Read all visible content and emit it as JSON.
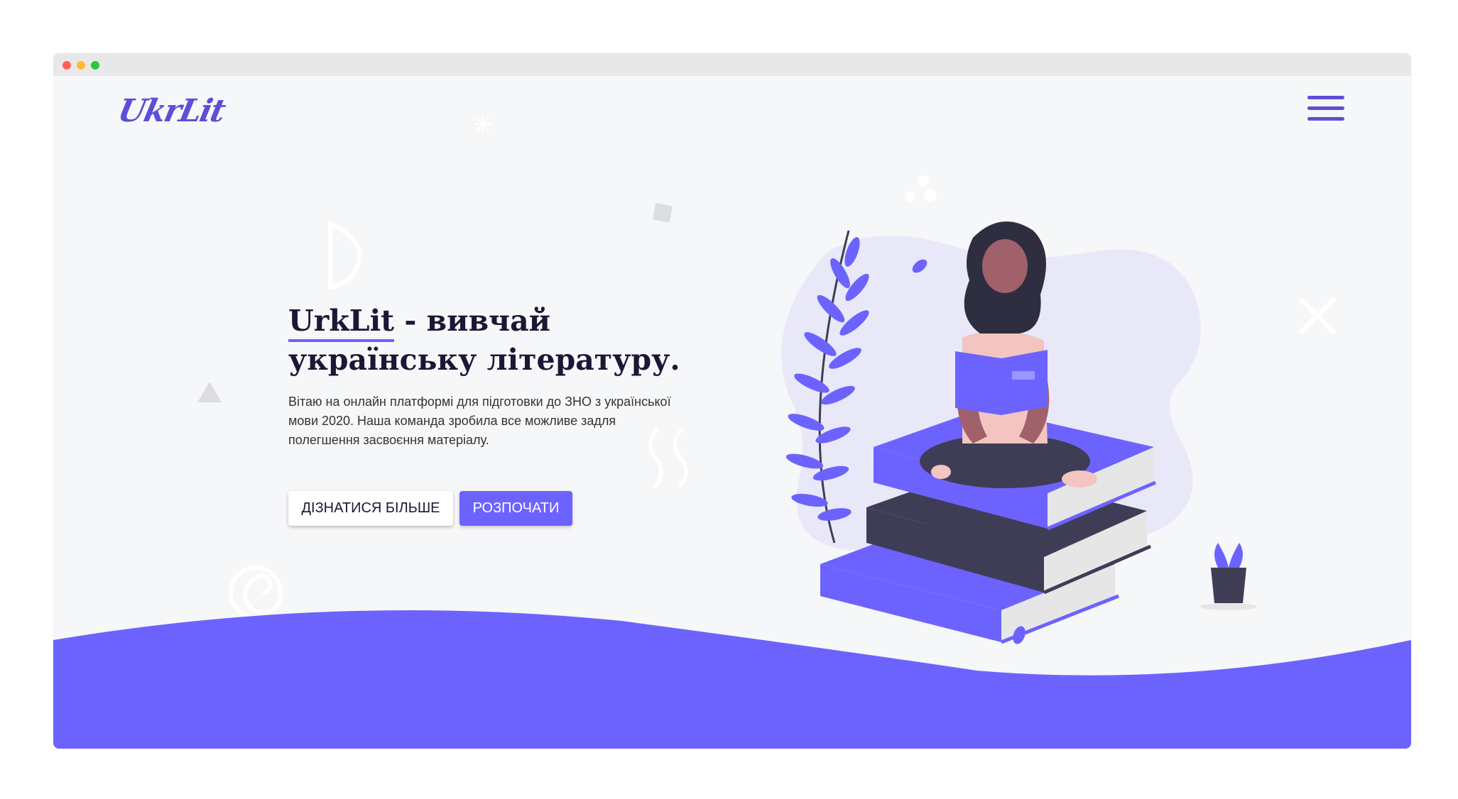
{
  "window": {
    "controls": [
      "close",
      "minimize",
      "maximize"
    ]
  },
  "header": {
    "logo_text": "UkrLit",
    "menu_icon": "hamburger-menu-icon"
  },
  "hero": {
    "title_brand": "UrkLit",
    "title_rest_line1": " - вивчай",
    "title_line2": "українську літературу.",
    "description": "Вітаю на онлайн платформі для підготовки до ЗНО з української мови 2020. Наша команда зробила все можливе задля полегшення засвоєння матеріалу.",
    "buttons": {
      "learn_more": "ДІЗНАТИСЯ БІЛЬШЕ",
      "start": "РОЗПОЧАТИ"
    },
    "illustration": "woman-reading-on-books-illustration"
  },
  "colors": {
    "accent": "#6c63ff",
    "logo": "#5a4fd6",
    "background": "#f6f7f8",
    "title": "#1b1836"
  }
}
